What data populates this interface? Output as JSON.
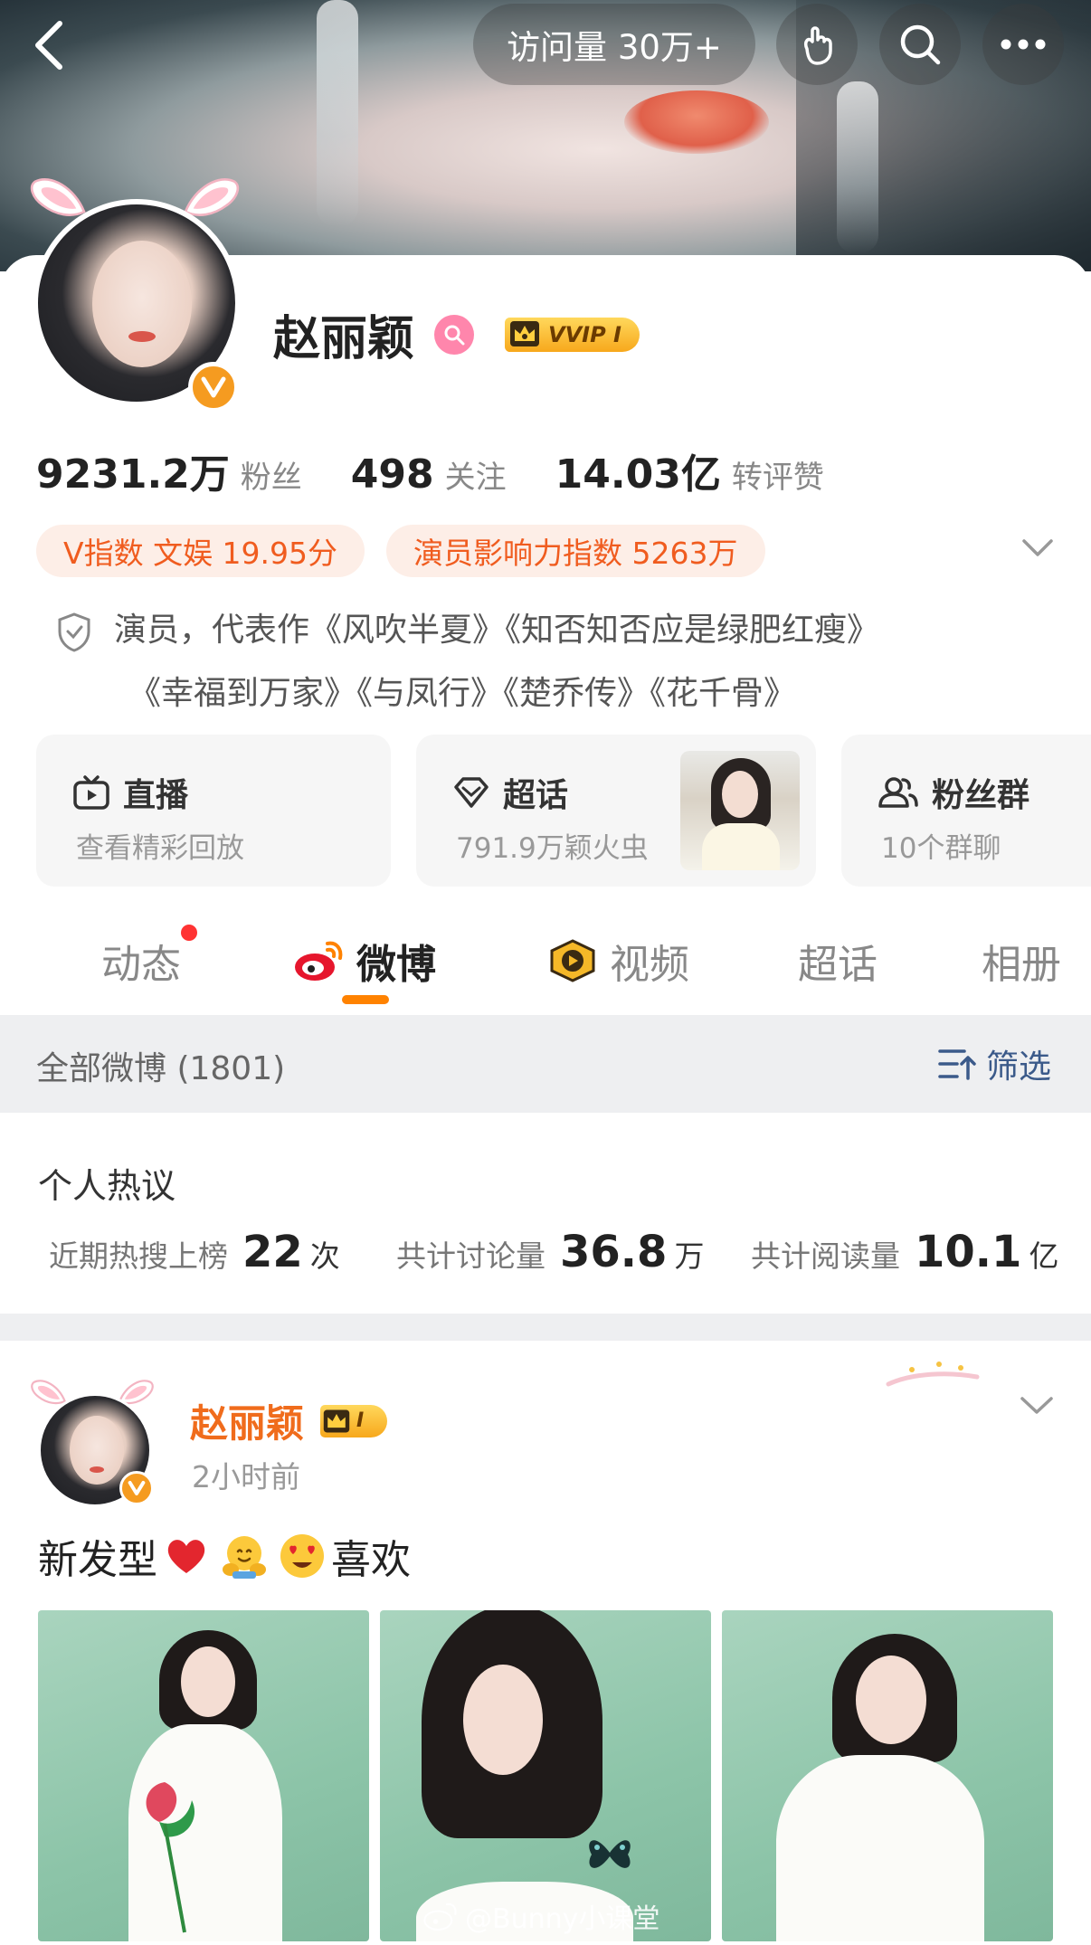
{
  "header": {
    "visits_label": "访问量 30万+",
    "icons": [
      "back-icon",
      "hand-icon",
      "search-icon",
      "more-icon"
    ]
  },
  "profile": {
    "name": "赵丽颖",
    "vip_label": "VVIP I",
    "stats": {
      "fans_value": "9231.2万",
      "fans_label": "粉丝",
      "following_value": "498",
      "following_label": "关注",
      "likes_value": "14.03亿",
      "likes_label": "转评赞"
    },
    "tags": [
      "V指数 文娱 19.95分",
      "演员影响力指数 5263万"
    ],
    "bio_line1": "演员，代表作《风吹半夏》《知否知否应是绿肥红瘦》",
    "bio_line2": "《幸福到万家》《与凤行》《楚乔传》《花千骨》"
  },
  "features": {
    "live": {
      "title": "直播",
      "sub": "查看精彩回放"
    },
    "super": {
      "title": "超话",
      "sub": "791.9万颖火虫"
    },
    "fans": {
      "title": "粉丝群",
      "sub": "10个群聊"
    }
  },
  "tabs": {
    "dynamic": "动态",
    "weibo": "微博",
    "video": "视频",
    "super": "超话",
    "album": "相册",
    "active": "weibo"
  },
  "filter": {
    "count_label": "全部微博 (1801)",
    "filter_label": "筛选"
  },
  "hot": {
    "title": "个人热议",
    "stats": [
      {
        "label": "近期热搜上榜",
        "value": "22",
        "unit": "次"
      },
      {
        "label": "共计讨论量",
        "value": "36.8",
        "unit": "万"
      },
      {
        "label": "共计阅读量",
        "value": "10.1",
        "unit": "亿"
      }
    ]
  },
  "post": {
    "author": "赵丽颖",
    "badge_label": "I",
    "time": "2小时前",
    "text_before": "新发型",
    "text_after": "喜欢",
    "emojis": [
      "heart",
      "hugging-face",
      "heart-eyes-face"
    ],
    "watermark": "@Bunny小课堂"
  },
  "colors": {
    "accent": "#ff8200",
    "name_orange": "#f06c1c",
    "tag_text": "#f05c1f",
    "tag_bg": "#fdeee7",
    "filter_blue": "#3b5a8a"
  }
}
